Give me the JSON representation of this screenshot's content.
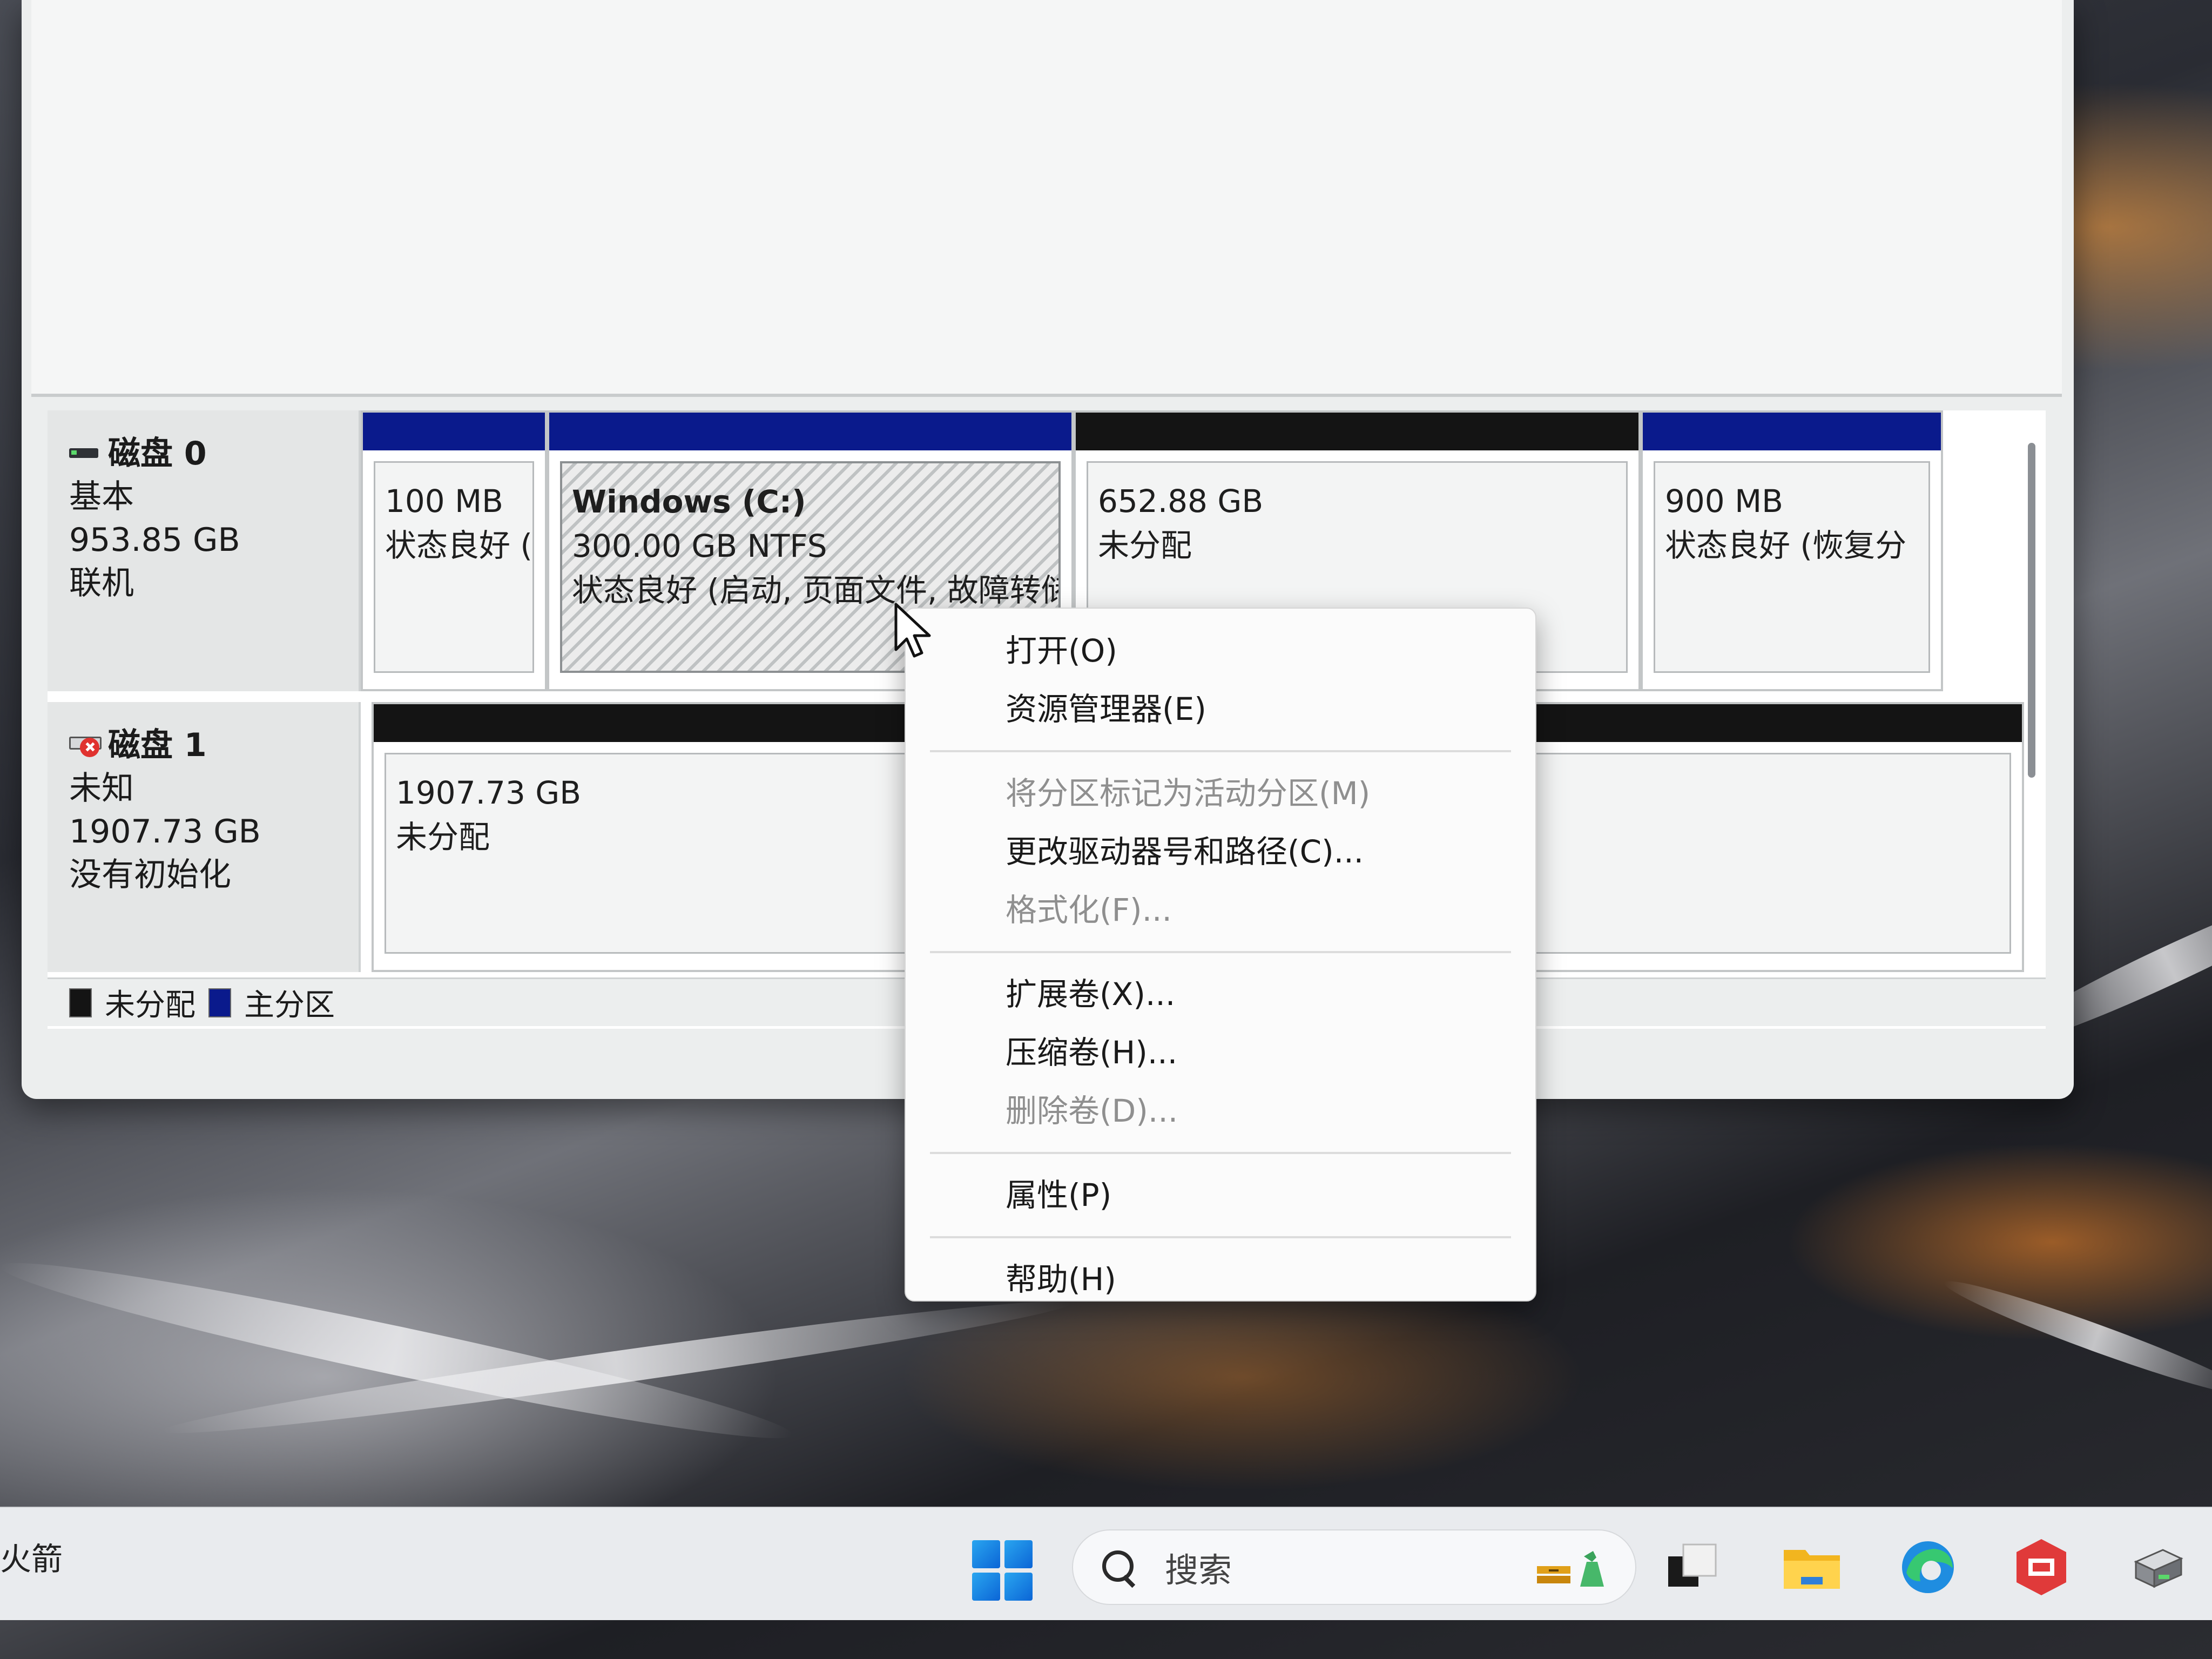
{
  "disks": [
    {
      "name": "磁盘 0",
      "type": "基本",
      "size": "953.85 GB",
      "status": "联机",
      "partitions": [
        {
          "line1": "100 MB",
          "line2": "状态良好 (",
          "line3": ""
        },
        {
          "name": "Windows  (C:)",
          "line1": "300.00 GB NTFS",
          "line2": "状态良好 (启动, 页面文件, 故障转储"
        },
        {
          "line1": "652.88 GB",
          "line2": "未分配"
        },
        {
          "line1": "900 MB",
          "line2": "状态良好 (恢复分"
        }
      ]
    },
    {
      "name": "磁盘 1",
      "type": "未知",
      "size": "1907.73 GB",
      "status": "没有初始化",
      "partitions": [
        {
          "line1": "1907.73 GB",
          "line2": "未分配"
        }
      ]
    }
  ],
  "legend": {
    "unallocated": "未分配",
    "primary": "主分区",
    "colors": {
      "unallocated": "#141414",
      "primary": "#0a1a8c"
    }
  },
  "context_menu": {
    "items": [
      {
        "label": "打开(O)",
        "enabled": true
      },
      {
        "label": "资源管理器(E)",
        "enabled": true
      },
      {
        "label": "将分区标记为活动分区(M)",
        "enabled": false
      },
      {
        "label": "更改驱动器号和路径(C)...",
        "enabled": true
      },
      {
        "label": "格式化(F)...",
        "enabled": false
      },
      {
        "label": "扩展卷(X)...",
        "enabled": true
      },
      {
        "label": "压缩卷(H)...",
        "enabled": true
      },
      {
        "label": "删除卷(D)...",
        "enabled": false
      },
      {
        "label": "属性(P)",
        "enabled": true
      },
      {
        "label": "帮助(H)",
        "enabled": true
      }
    ]
  },
  "taskbar": {
    "left_label": "火箭",
    "search_placeholder": "搜索",
    "icons": [
      "windows-start-icon",
      "search-icon",
      "task-view-icon",
      "file-explorer-icon",
      "edge-icon",
      "security-app-icon",
      "disk-management-icon"
    ],
    "accent": "#1a6fd6"
  }
}
